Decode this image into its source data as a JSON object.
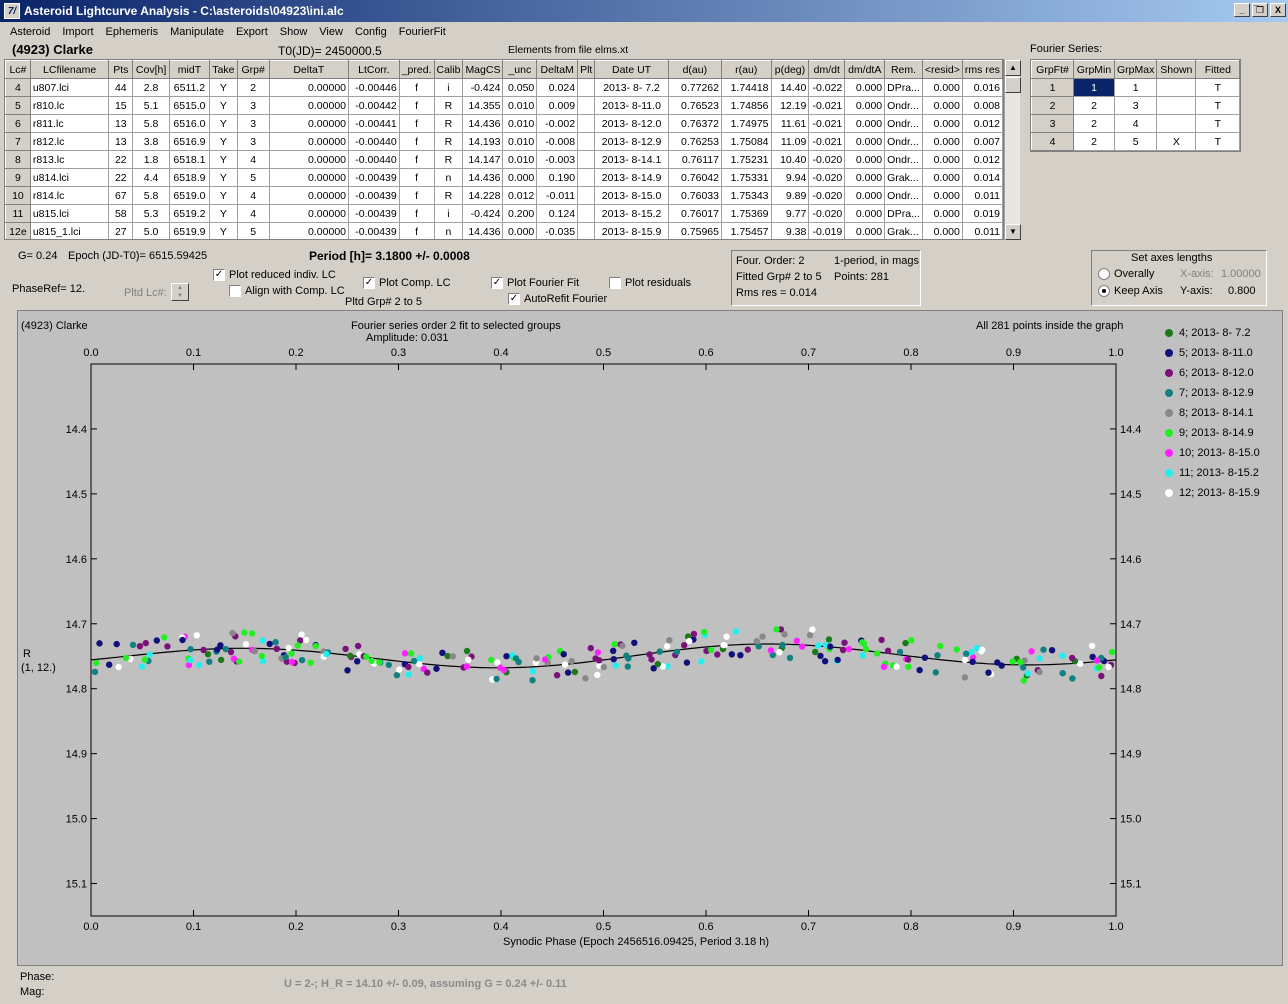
{
  "window": {
    "title": "Asteroid Lightcurve Analysis - C:\\asteroids\\04923\\ini.alc",
    "icon_label": "7/",
    "buttons": [
      "_",
      "̅❐",
      "X"
    ]
  },
  "menu": [
    "Asteroid",
    "Import",
    "Ephemeris",
    "Manipulate",
    "Export",
    "Show",
    "View",
    "Config",
    "FourierFit"
  ],
  "header": {
    "asteroid": "(4923) Clarke",
    "t0": "T0(JD)= 2450000.5",
    "elements": "Elements from file elms.xt"
  },
  "lc_table": {
    "columns": [
      "Lc#",
      "LCfilename",
      "Pts",
      "Cov[h]",
      "midT",
      "Take",
      "Grp#",
      "DeltaT",
      "LtCorr.",
      "_pred.",
      "Calib",
      "MagCS",
      "_unc",
      "DeltaM",
      "Plt",
      "Date UT",
      "d(au)",
      "r(au)",
      "p(deg)",
      "dm/dt",
      "dm/dtA",
      "Rem.",
      "<resid>",
      "rms res"
    ],
    "rows": [
      [
        "4",
        "u807.lci",
        "44",
        "2.8",
        "6511.2",
        "Y",
        "2",
        "0.00000",
        "-0.00446",
        "f",
        "i",
        "-0.424",
        "0.050",
        "0.024",
        "",
        "2013- 8- 7.2",
        "0.77262",
        "1.74418",
        "14.40",
        "-0.022",
        "0.000",
        "DPra...",
        "0.000",
        "0.016"
      ],
      [
        "5",
        "r810.lc",
        "15",
        "5.1",
        "6515.0",
        "Y",
        "3",
        "0.00000",
        "-0.00442",
        "f",
        "R",
        "14.355",
        "0.010",
        "0.009",
        "",
        "2013- 8-11.0",
        "0.76523",
        "1.74856",
        "12.19",
        "-0.021",
        "0.000",
        "Ondr...",
        "0.000",
        "0.008"
      ],
      [
        "6",
        "r811.lc",
        "13",
        "5.8",
        "6516.0",
        "Y",
        "3",
        "0.00000",
        "-0.00441",
        "f",
        "R",
        "14.436",
        "0.010",
        "-0.002",
        "",
        "2013- 8-12.0",
        "0.76372",
        "1.74975",
        "11.61",
        "-0.021",
        "0.000",
        "Ondr...",
        "0.000",
        "0.012"
      ],
      [
        "7",
        "r812.lc",
        "13",
        "3.8",
        "6516.9",
        "Y",
        "3",
        "0.00000",
        "-0.00440",
        "f",
        "R",
        "14.193",
        "0.010",
        "-0.008",
        "",
        "2013- 8-12.9",
        "0.76253",
        "1.75084",
        "11.09",
        "-0.021",
        "0.000",
        "Ondr...",
        "0.000",
        "0.007"
      ],
      [
        "8",
        "r813.lc",
        "22",
        "1.8",
        "6518.1",
        "Y",
        "4",
        "0.00000",
        "-0.00440",
        "f",
        "R",
        "14.147",
        "0.010",
        "-0.003",
        "",
        "2013- 8-14.1",
        "0.76117",
        "1.75231",
        "10.40",
        "-0.020",
        "0.000",
        "Ondr...",
        "0.000",
        "0.012"
      ],
      [
        "9",
        "u814.lci",
        "22",
        "4.4",
        "6518.9",
        "Y",
        "5",
        "0.00000",
        "-0.00439",
        "f",
        "n",
        "14.436",
        "0.000",
        "0.190",
        "",
        "2013- 8-14.9",
        "0.76042",
        "1.75331",
        "9.94",
        "-0.020",
        "0.000",
        "Grak...",
        "0.000",
        "0.014"
      ],
      [
        "10",
        "r814.lc",
        "67",
        "5.8",
        "6519.0",
        "Y",
        "4",
        "0.00000",
        "-0.00439",
        "f",
        "R",
        "14.228",
        "0.012",
        "-0.011",
        "",
        "2013- 8-15.0",
        "0.76033",
        "1.75343",
        "9.89",
        "-0.020",
        "0.000",
        "Ondr...",
        "0.000",
        "0.011"
      ],
      [
        "11",
        "u815.lci",
        "58",
        "5.3",
        "6519.2",
        "Y",
        "4",
        "0.00000",
        "-0.00439",
        "f",
        "i",
        "-0.424",
        "0.200",
        "0.124",
        "",
        "2013- 8-15.2",
        "0.76017",
        "1.75369",
        "9.77",
        "-0.020",
        "0.000",
        "DPra...",
        "0.000",
        "0.019"
      ],
      [
        "12e",
        "u815_1.lci",
        "27",
        "5.0",
        "6519.9",
        "Y",
        "5",
        "0.00000",
        "-0.00439",
        "f",
        "n",
        "14.436",
        "0.000",
        "-0.035",
        "",
        "2013- 8-15.9",
        "0.75965",
        "1.75457",
        "9.38",
        "-0.019",
        "0.000",
        "Grak...",
        "0.000",
        "0.011"
      ]
    ]
  },
  "fourier_series": {
    "title": "Fourier Series:",
    "columns": [
      "GrpFt#",
      "GrpMin",
      "GrpMax",
      "Shown",
      "Fitted"
    ],
    "rows": [
      [
        "1",
        "1",
        "1",
        "",
        "T"
      ],
      [
        "2",
        "2",
        "3",
        "",
        "T"
      ],
      [
        "3",
        "2",
        "4",
        "",
        "T"
      ],
      [
        "4",
        "2",
        "5",
        "X",
        "T"
      ]
    ]
  },
  "controls": {
    "g_value": "G= 0.24",
    "epoch": "Epoch (JD-T0)= 6515.59425",
    "period": "Period [h]= 3.1800 +/- 0.0008",
    "phase_ref": "PhaseRef= 12.",
    "pltd_lc": "Pltd Lc#:",
    "plot_reduced": "Plot reduced indiv. LC",
    "align_comp": "Align with Comp. LC",
    "plot_comp": "Plot Comp. LC",
    "pltd_grp": "Pltd Grp#  2   to   5",
    "plot_fourier": "Plot Fourier Fit",
    "autorefit": "AutoRefit Fourier",
    "plot_residuals": "Plot residuals",
    "check_mark": "✓"
  },
  "fit_info": {
    "four_order": "Four. Order:  2",
    "one_period": "1-period, in mags",
    "fitted_grp": "Fitted Grp# 2 to 5",
    "points": "Points: 281",
    "rms": "Rms res     = 0.014"
  },
  "axes_panel": {
    "title": "Set axes lengths",
    "overally": "Overally",
    "keep_axis": "Keep Axis",
    "x_label": "X-axis:",
    "x_value": "1.00000",
    "y_label": "Y-axis:",
    "y_value": "0.800"
  },
  "plot": {
    "name": "(4923) Clarke",
    "title_line1": "Fourier series order 2 fit to selected groups",
    "title_line2": "Amplitude: 0.031",
    "points_note": "All 281 points inside the graph",
    "ylabel_line1": "R",
    "ylabel_line2": "(1, 12.)",
    "xlabel": "Synodic Phase (Epoch 2456516.09425, Period 3.18 h)"
  },
  "chart_data": {
    "type": "scatter",
    "xlim": [
      0.0,
      1.0
    ],
    "ylim": [
      14.3,
      15.15
    ],
    "y_inverted": true,
    "x_ticks": [
      "0.0",
      "0.1",
      "0.2",
      "0.3",
      "0.4",
      "0.5",
      "0.6",
      "0.7",
      "0.8",
      "0.9",
      "1.0"
    ],
    "y_ticks": [
      "14.4",
      "14.5",
      "14.6",
      "14.7",
      "14.8",
      "14.9",
      "15.0",
      "15.1"
    ],
    "fourier_amplitude": 0.031,
    "fourier_mean": 14.75,
    "series": [
      {
        "name": "4; 2013- 8- 7.2",
        "color": "#1a7a1a"
      },
      {
        "name": "5; 2013- 8-11.0",
        "color": "#10107a"
      },
      {
        "name": "6; 2013- 8-12.0",
        "color": "#7a107a"
      },
      {
        "name": "7; 2013- 8-12.9",
        "color": "#108080"
      },
      {
        "name": "8; 2013- 8-14.1",
        "color": "#888888"
      },
      {
        "name": "9; 2013- 8-14.9",
        "color": "#22ee22"
      },
      {
        "name": "10; 2013- 8-15.0",
        "color": "#ff22ff"
      },
      {
        "name": "11; 2013- 8-15.2",
        "color": "#22eeee"
      },
      {
        "name": "12; 2013- 8-15.9",
        "color": "#ffffff"
      }
    ]
  },
  "status": {
    "phase": "Phase:",
    "mag": "Mag:",
    "result": "U = 2-; H_R = 14.10 +/- 0.09, assuming G = 0.24 +/- 0.11"
  }
}
